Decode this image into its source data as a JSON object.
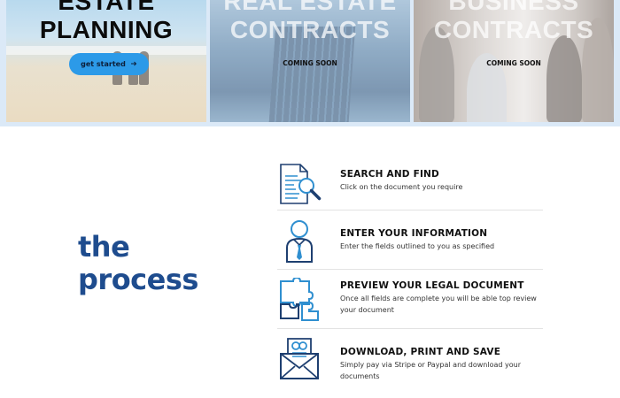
{
  "hero": {
    "cards": [
      {
        "title_line1": "ESTATE",
        "title_line2": "PLANNING",
        "button_label": "get started",
        "button_icon": "arrow-right-icon"
      },
      {
        "title_line1": "REAL ESTATE",
        "title_line2": "CONTRACTS",
        "status": "COMING SOON"
      },
      {
        "title_line1": "BUSINESS",
        "title_line2": "CONTRACTS",
        "status": "COMING SOON"
      }
    ]
  },
  "process": {
    "title_line1": "the",
    "title_line2": "process",
    "steps": [
      {
        "icon": "document-search-icon",
        "heading": "SEARCH AND FIND",
        "text": "Click on the document you require"
      },
      {
        "icon": "person-tie-icon",
        "heading": "ENTER YOUR INFORMATION",
        "text": "Enter the fields outlined to you as specified"
      },
      {
        "icon": "puzzle-icon",
        "heading": "PREVIEW YOUR LEGAL DOCUMENT",
        "text": "Once all fields are complete you will be able top review your document"
      },
      {
        "icon": "envelope-document-icon",
        "heading": "DOWNLOAD, PRINT AND SAVE",
        "text": "Simply pay via Stripe or Paypal and download your documents"
      }
    ]
  },
  "colors": {
    "accent_blue": "#2c9ae8",
    "title_blue": "#1e4c8e",
    "icon_blue": "#2f8fd0",
    "icon_navy": "#1e3f70"
  }
}
